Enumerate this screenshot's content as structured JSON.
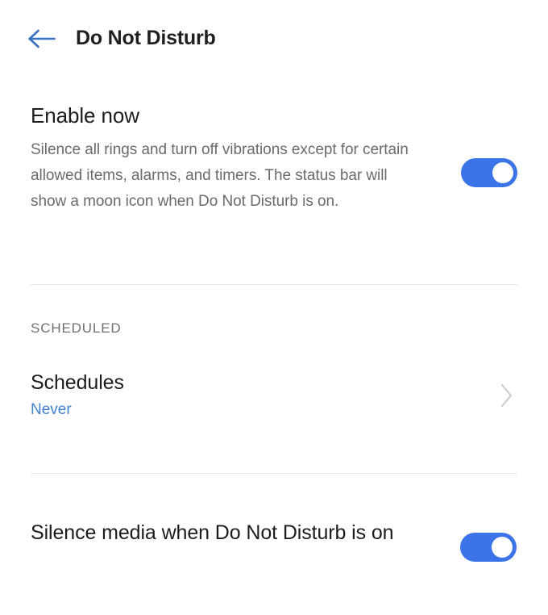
{
  "header": {
    "back_icon": "arrow-left-icon",
    "title": "Do Not Disturb"
  },
  "sections": {
    "enable": {
      "title": "Enable now",
      "description": "Silence all rings and turn off vibrations except for certain allowed items, alarms, and timers. The status bar will show a moon icon when Do Not Disturb is on.",
      "toggle_state": "on"
    },
    "scheduled": {
      "label": "SCHEDULED",
      "schedules": {
        "title": "Schedules",
        "value": "Never",
        "chevron_icon": "chevron-right-icon"
      }
    },
    "silence_media": {
      "title": "Silence media when Do Not Disturb is on",
      "toggle_state": "on"
    }
  },
  "colors": {
    "accent_blue": "#3b74e8",
    "link_blue": "#4082d3",
    "back_arrow_blue": "#3b6fc4",
    "text_primary": "#1c1c1c",
    "text_secondary": "#6b6b6b",
    "section_label": "#707070",
    "divider": "#e8e8e8",
    "chevron_grey": "#cfcfcf",
    "background": "#ffffff"
  }
}
